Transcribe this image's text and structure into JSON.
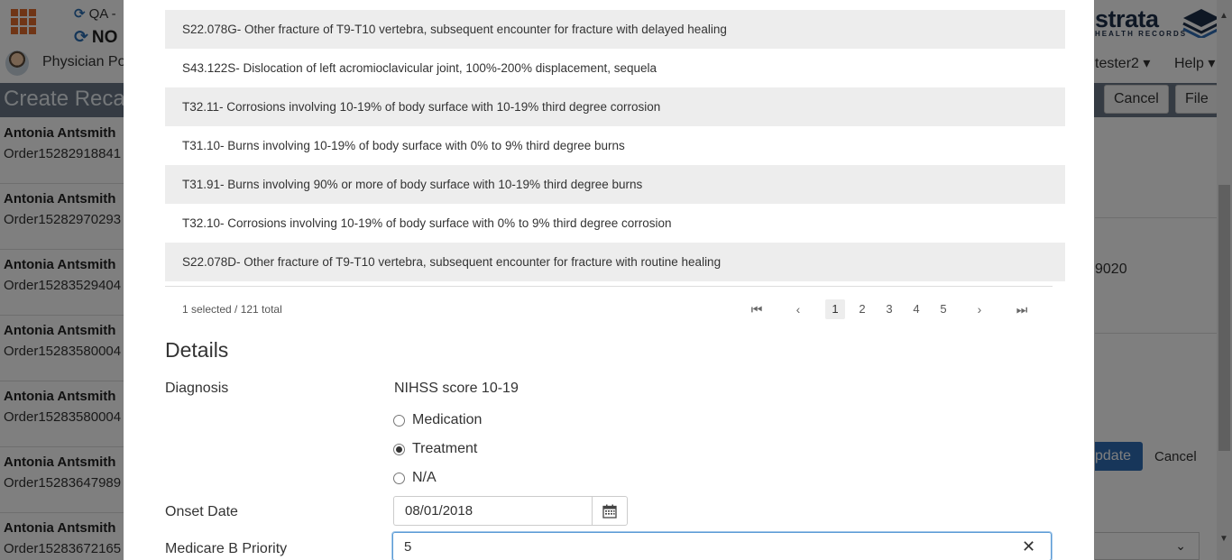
{
  "background": {
    "qa_label": "QA -",
    "no_label": "NO",
    "physician_label": "Physician Po",
    "page_title": "Create Recap",
    "list": [
      {
        "name": "Antonia Antsmith",
        "order": "Order15282918841"
      },
      {
        "name": "Antonia Antsmith",
        "order": "Order15282970293"
      },
      {
        "name": "Antonia Antsmith",
        "order": "Order15283529404"
      },
      {
        "name": "Antonia Antsmith",
        "order": "Order15283580004"
      },
      {
        "name": "Antonia Antsmith",
        "order": "Order15283580004"
      },
      {
        "name": "Antonia Antsmith",
        "order": "Order15283647989"
      },
      {
        "name": "Antonia Antsmith",
        "order": "Order15283672165"
      }
    ],
    "logo_word": "strata",
    "logo_sub": "HEALTH RECORDS",
    "user_label": "tester2 ▾",
    "help_label": "Help ▾",
    "cancel_label": "Cancel",
    "file_label": "File",
    "right_number": "9020",
    "update_label": "pdate",
    "cancel2_label": "Cancel",
    "colors": {
      "accent": "#2f6db5",
      "brand_orange": "#e06a2c",
      "title_bar": "#6b7686"
    }
  },
  "modal": {
    "rows": [
      "S22.078G- Other fracture of T9-T10 vertebra, subsequent encounter for fracture with delayed healing",
      "S43.122S- Dislocation of left acromioclavicular joint, 100%-200% displacement, sequela",
      "T32.11- Corrosions involving 10-19% of body surface with 10-19% third degree corrosion",
      "T31.10- Burns involving 10-19% of body surface with 0% to 9% third degree burns",
      "T31.91- Burns involving 90% or more of body surface with 10-19% third degree burns",
      "T32.10- Corrosions involving 10-19% of body surface with 0% to 9% third degree corrosion",
      "S22.078D- Other fracture of T9-T10 vertebra, subsequent encounter for fracture with routine healing"
    ],
    "selection_status": "1 selected / 121 total",
    "pages": [
      "1",
      "2",
      "3",
      "4",
      "5"
    ],
    "active_page": "1",
    "details_heading": "Details",
    "diagnosis_label": "Diagnosis",
    "diagnosis_value": "NIHSS score 10-19",
    "radio_options": [
      {
        "label": "Medication",
        "checked": false
      },
      {
        "label": "Treatment",
        "checked": true
      },
      {
        "label": "N/A",
        "checked": false
      }
    ],
    "onset_label": "Onset Date",
    "onset_value": "08/01/2018",
    "priority_label": "Medicare B Priority",
    "priority_value": "5"
  }
}
